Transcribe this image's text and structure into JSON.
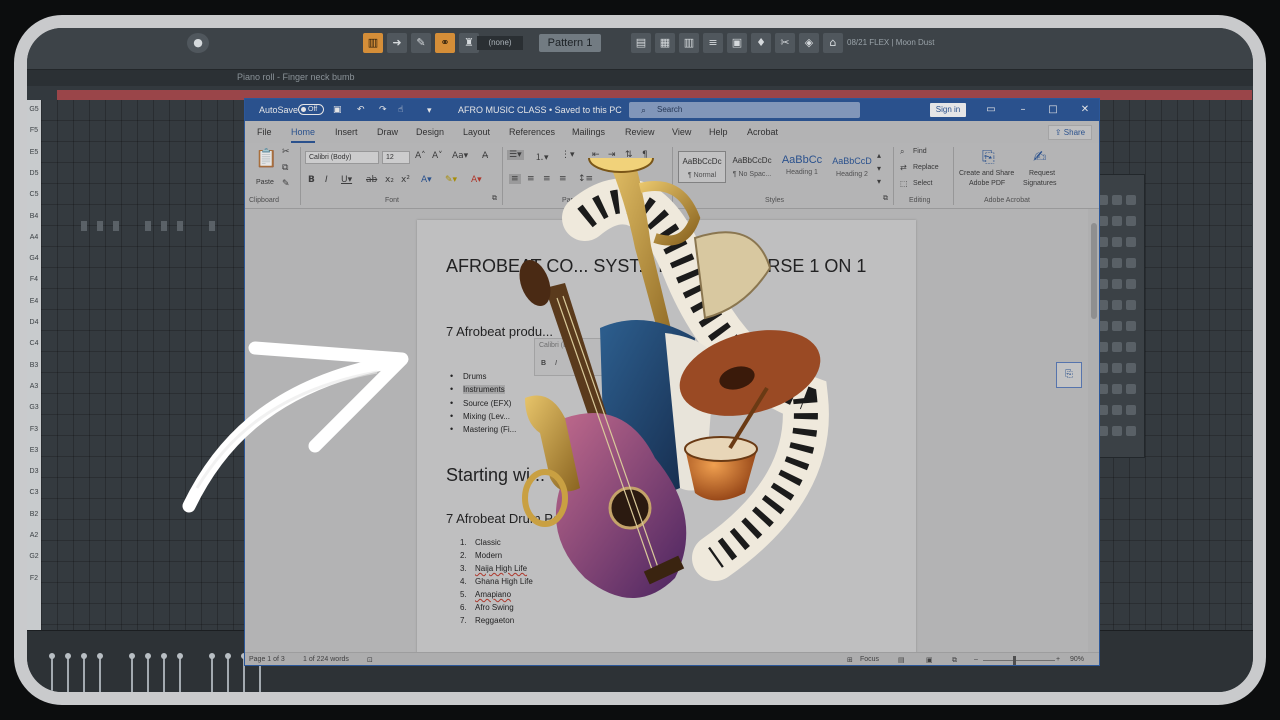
{
  "fl": {
    "pattern_label": "Pattern 1",
    "channel_none": "(none)",
    "song_label": "08/21  FLEX | Moon Dust",
    "pianoroll_title": "Piano roll - Finger neck bumb",
    "keys": [
      "G5",
      "F5",
      "E5",
      "D5",
      "C5",
      "B4",
      "A4",
      "G4",
      "F4",
      "E4",
      "D4",
      "C4",
      "B3",
      "A3",
      "G3",
      "F3",
      "E3",
      "D3",
      "C3",
      "B2",
      "A2",
      "G2",
      "F2"
    ]
  },
  "word": {
    "autosave_label": "AutoSave",
    "autosave_state": "Off",
    "doc_title": "AFRO MUSIC CLASS  •  Saved to this PC",
    "search_placeholder": "Search",
    "signin_label": "Sign in",
    "share_label": "Share",
    "menus": [
      "File",
      "Home",
      "Insert",
      "Draw",
      "Design",
      "Layout",
      "References",
      "Mailings",
      "Review",
      "View",
      "Help",
      "Acrobat"
    ],
    "ribbon": {
      "paste": "Paste",
      "clipboard": "Clipboard",
      "font_name": "Calibri (Body)",
      "font_size": "12",
      "font": "Font",
      "paragraph": "Paragraph",
      "styles": "Styles",
      "style_items": [
        {
          "preview": "AaBbCcDc",
          "name": "¶ Normal"
        },
        {
          "preview": "AaBbCcDc",
          "name": "¶ No Spac..."
        },
        {
          "preview": "AaBbCc",
          "name": "Heading 1"
        },
        {
          "preview": "AaBbCcD",
          "name": "Heading 2"
        }
      ],
      "find": "Find",
      "replace": "Replace",
      "select": "Select",
      "editing": "Editing",
      "create_share_1": "Create and Share",
      "create_share_2": "Adobe PDF",
      "request_1": "Request",
      "request_2": "Signatures",
      "adobe_acrobat": "Adobe Acrobat"
    },
    "document": {
      "title": "AFROBEAT CO... SYST... BI... ...S COURSE 1 ON 1",
      "heading_products": "7 Afrobeat produ...",
      "bullets": [
        "Drums",
        "Instruments",
        "Source (EFX)",
        "Mixing (Lev...",
        "Mastering (Fi..."
      ],
      "starting": "Starting wi...",
      "drum_heading": "7 Afrobeat Drum Patte...",
      "numbered": [
        "Classic",
        "Modern",
        "Naija High Life",
        "Ghana High Life",
        "Amapiano",
        "Afro Swing",
        "Reggaeton"
      ],
      "mini_font": "Calibri (B..."
    },
    "status": {
      "page": "Page 1 of 3",
      "words": "1 of 224 words",
      "focus": "Focus",
      "zoom": "90%"
    }
  },
  "colors": {
    "word_blue": "#2b579a",
    "fl_red": "#9a4549",
    "frame": "#c9cacc"
  }
}
